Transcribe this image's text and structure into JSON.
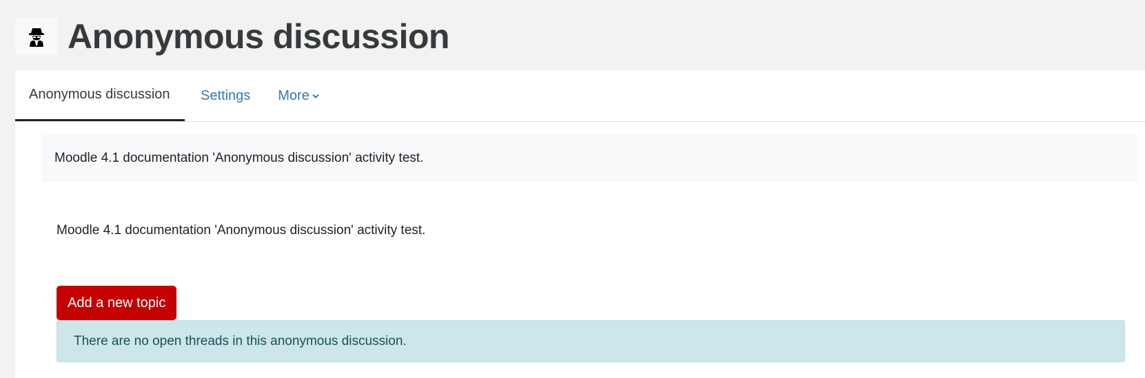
{
  "header": {
    "icon": "spy-icon",
    "title": "Anonymous discussion"
  },
  "nav": {
    "tabs": [
      {
        "label": "Anonymous discussion",
        "active": true
      },
      {
        "label": "Settings",
        "active": false
      },
      {
        "label": "More",
        "active": false,
        "icon": "chevron-down-icon"
      }
    ]
  },
  "intro": {
    "text": "Moodle 4.1 documentation 'Anonymous discussion' activity test."
  },
  "main": {
    "description": "Moodle 4.1 documentation 'Anonymous discussion' activity test.",
    "add_topic_label": "Add a new topic",
    "alert_text": "There are no open threads in this anonymous discussion."
  },
  "colors": {
    "button": "#c40000",
    "link": "#3a78ad",
    "alert_bg": "#cce6ea"
  }
}
